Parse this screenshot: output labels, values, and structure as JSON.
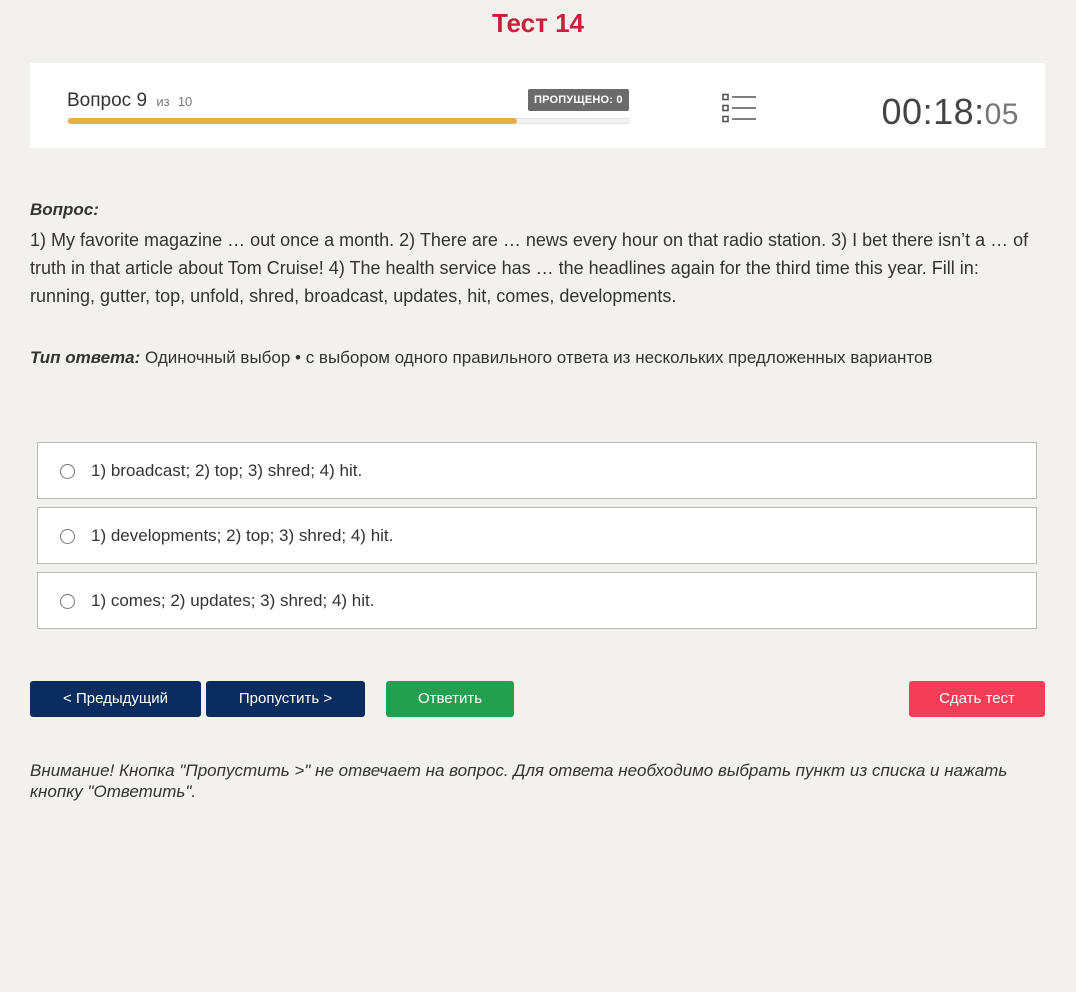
{
  "test": {
    "title": "Тест 14"
  },
  "header": {
    "question_label": "Вопрос",
    "question_number": "9",
    "of_label": "из",
    "question_total": "10",
    "skipped_badge": "ПРОПУЩЕНО: 0",
    "progress_fraction": 0.8,
    "list_icon": "list-icon",
    "timer_main": "00:18:",
    "timer_seconds": "05"
  },
  "question": {
    "heading": "Вопрос:",
    "text": "1) My favorite magazine … out once a month. 2) There are … news every hour on that radio station. 3) I bet there isn’t a … of truth in that article about Tom Cruise! 4) The health service has … the headlines again for the third time this year. Fill in: running, gutter, top, unfold, shred, broadcast, updates, hit, comes, developments."
  },
  "answer_type": {
    "label": "Тип ответа:",
    "value": "Одиночный выбор • с выбором одного правильного ответа из нескольких предложенных вариантов"
  },
  "options": [
    {
      "text": "1) broadcast; 2) top; 3) shred; 4) hit."
    },
    {
      "text": "1) developments; 2) top; 3) shred; 4) hit."
    },
    {
      "text": "1) comes; 2) updates; 3) shred; 4) hit."
    }
  ],
  "buttons": {
    "prev": "< Предыдущий",
    "skip": "Пропустить >",
    "answer": "Ответить",
    "submit": "Сдать тест"
  },
  "colors": {
    "title": "#c8203a",
    "progress": "#eaae45",
    "nav_button": "#0b2c5e",
    "answer_button": "#22a04f",
    "submit_button": "#f53d57"
  },
  "notice": "Внимание! Кнопка \"Пропустить >\" не отвечает на вопрос. Для ответа необходимо выбрать пункт из списка и нажать кнопку \"Ответить\"."
}
